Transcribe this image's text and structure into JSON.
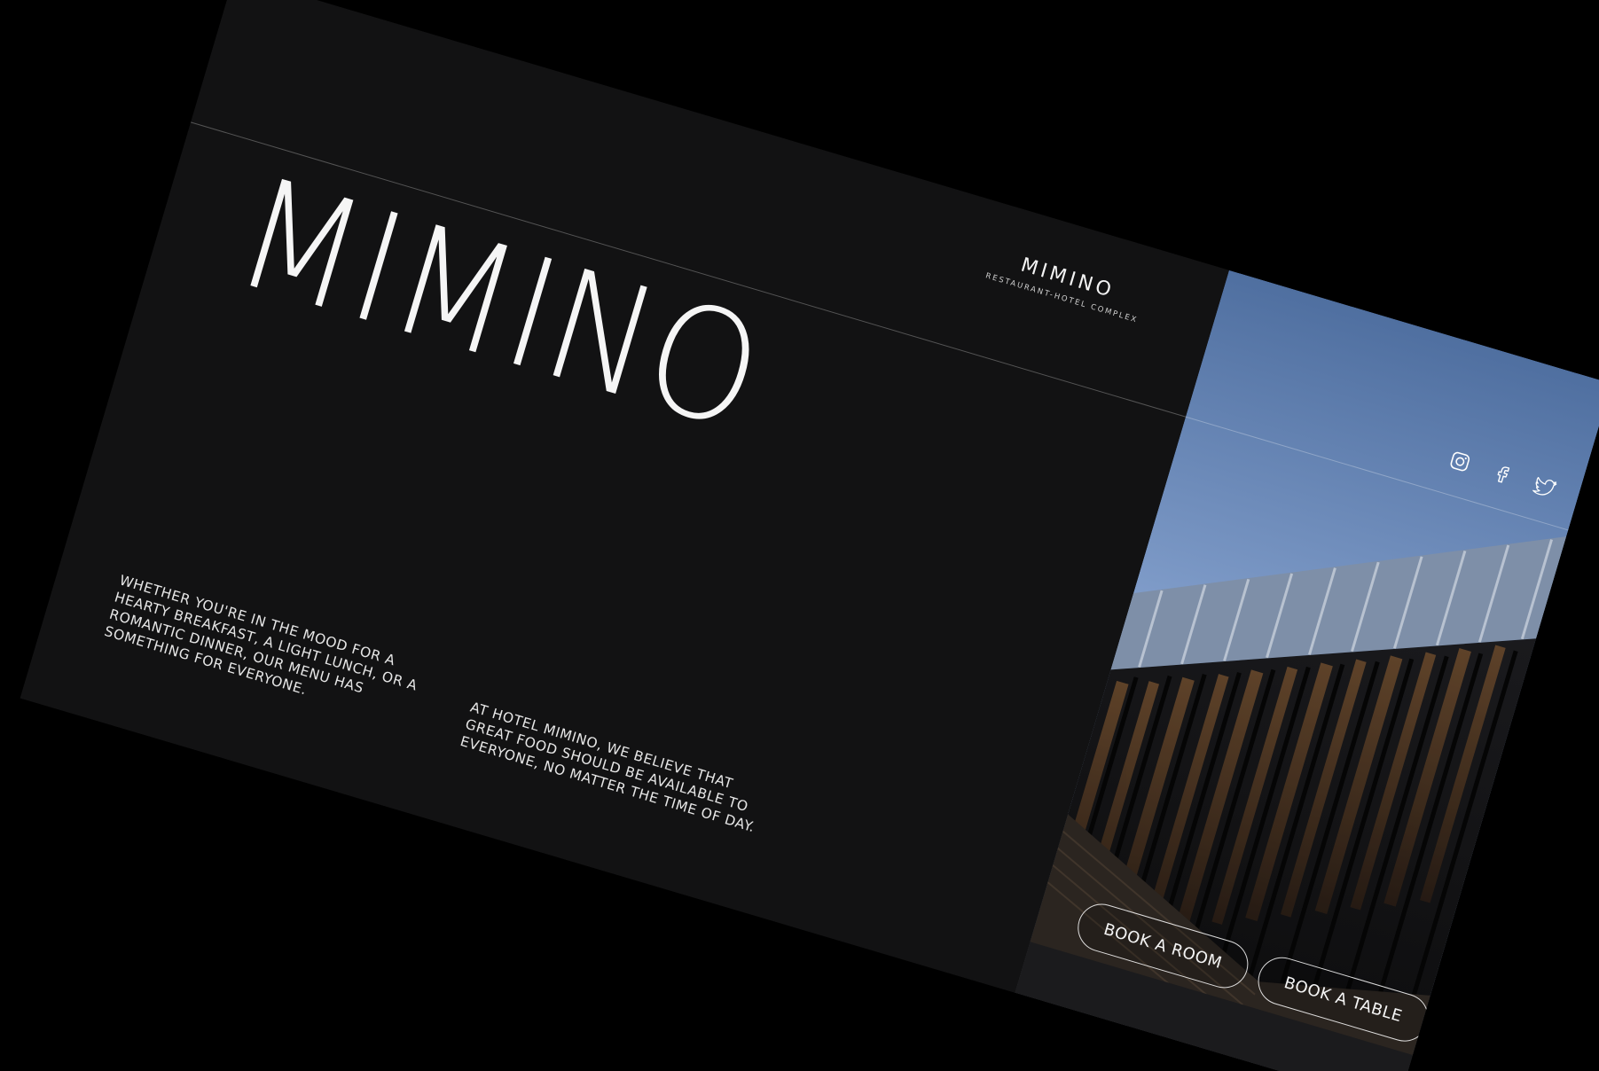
{
  "brand": {
    "name": "MIMINO",
    "tagline": "RESTAURANT-HOTEL COMPLEX"
  },
  "hero": {
    "title": "MIMINO"
  },
  "copy": {
    "left": "WHETHER YOU'RE IN THE MOOD FOR A HEARTY BREAKFAST, A LIGHT LUNCH, OR A ROMANTIC DINNER, OUR MENU HAS SOMETHING FOR EVERYONE.",
    "right": "AT HOTEL MIMINO, WE BELIEVE THAT GREAT FOOD SHOULD BE AVAILABLE TO EVERYONE, NO MATTER THE TIME OF DAY."
  },
  "socials": [
    {
      "name": "instagram-icon"
    },
    {
      "name": "facebook-icon"
    },
    {
      "name": "twitter-icon"
    }
  ],
  "actions": {
    "book_room": "BOOK A ROOM",
    "book_table": "BOOK  A TABLE"
  },
  "colors": {
    "background": "#000000",
    "panel": "#121213",
    "text": "#f2f2f2",
    "sky_top": "#4f6fa0",
    "sky_bottom": "#a9c0e3"
  }
}
